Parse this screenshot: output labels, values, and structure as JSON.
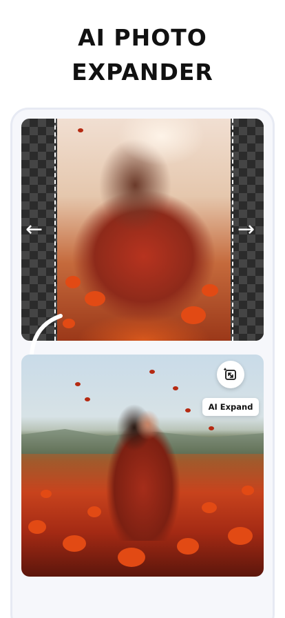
{
  "headline": {
    "line1": "AI PHOTO",
    "line2": "EXPANDER"
  },
  "before_panel": {
    "left_arrow": "←",
    "right_arrow": "→"
  },
  "after_panel": {
    "expand_button_icon": "expand-sparkle-icon",
    "expand_label": "AI Expand"
  },
  "colors": {
    "background": "#ffffff",
    "card": "#f6f7fb",
    "card_border": "#e7eaf3",
    "text": "#111111",
    "poppy": "#e24a14"
  }
}
